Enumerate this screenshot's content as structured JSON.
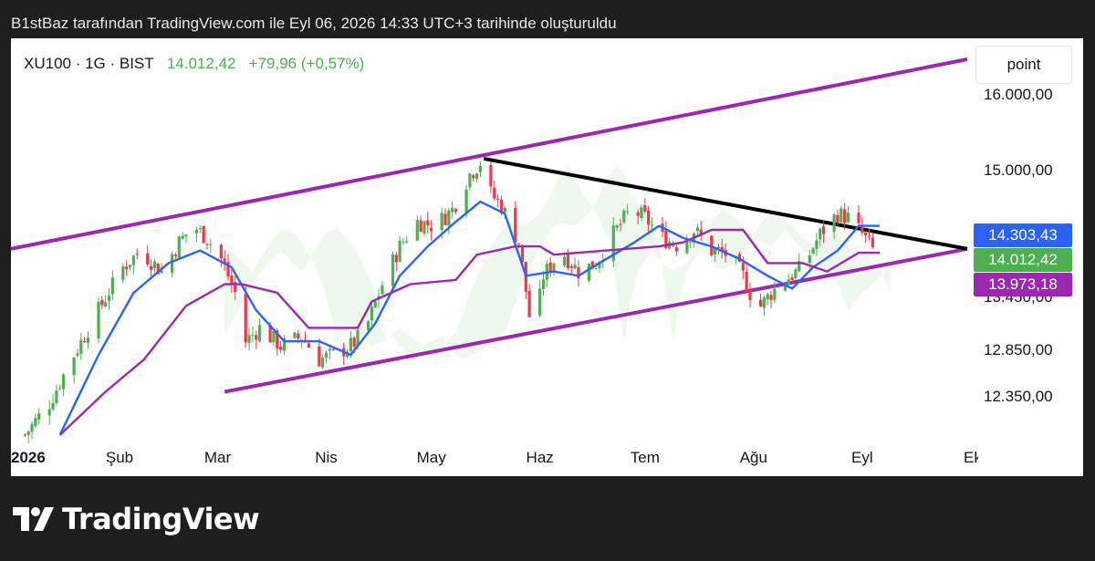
{
  "caption": "B1stBaz tarafından TradingView.com ile Eyl 06, 2026 14:33 UTC+3 tarihinde oluşturuldu",
  "header": {
    "symbol": "XU100 · 1G · BIST",
    "last": "14.012,42",
    "change": "+79,96 (+0,57%)"
  },
  "price_scale_mode": "point",
  "brand": {
    "name": "TradingView"
  },
  "colors": {
    "up": "#4caf50",
    "down": "#f23645",
    "channel": "#9c27b0",
    "conversion": "#2962ff",
    "base": "#7b1fa2",
    "trend": "#000000",
    "cloud_green": "#4caf50",
    "cloud_red": "#f23645"
  },
  "chart_data": {
    "type": "candlestick",
    "title": "XU100 · 1G · BIST",
    "y_scale": "log",
    "ylim": [
      11900,
      16800
    ],
    "y_ticks": [
      {
        "value": 16000,
        "label": "16.000,00"
      },
      {
        "value": 15000,
        "label": "15.000,00"
      },
      {
        "value": 13450,
        "label": "13.450,00"
      },
      {
        "value": 12850,
        "label": "12.850,00"
      },
      {
        "value": 12350,
        "label": "12.350,00"
      }
    ],
    "x_ticks": [
      {
        "date": "2026-01-01",
        "label": "2026"
      },
      {
        "date": "2026-02-01",
        "label": "Şub"
      },
      {
        "date": "2026-03-01",
        "label": "Mar"
      },
      {
        "date": "2026-04-01",
        "label": "Nis"
      },
      {
        "date": "2026-05-01",
        "label": "May"
      },
      {
        "date": "2026-06-01",
        "label": "Haz"
      },
      {
        "date": "2026-07-01",
        "label": "Tem"
      },
      {
        "date": "2026-08-01",
        "label": "Ağu"
      },
      {
        "date": "2026-09-01",
        "label": "Eyl"
      },
      {
        "date": "2026-10-01",
        "label": "Eki"
      }
    ],
    "xlim": [
      "2026-01-01",
      "2026-10-01"
    ],
    "price_badges": [
      {
        "name": "conversion_line",
        "value": "14.303,43",
        "color": "#2962ff"
      },
      {
        "name": "last_price",
        "value": "14.012,42",
        "color": "#4caf50"
      },
      {
        "name": "base_line",
        "value": "13.973,18",
        "color": "#9c27b0"
      }
    ],
    "close_path": [
      [
        "2026-01-05",
        11950
      ],
      [
        "2026-01-12",
        12280
      ],
      [
        "2026-01-19",
        12800
      ],
      [
        "2026-01-26",
        13300
      ],
      [
        "2026-02-02",
        13800
      ],
      [
        "2026-02-07",
        14000
      ],
      [
        "2026-02-13",
        13750
      ],
      [
        "2026-02-18",
        14100
      ],
      [
        "2026-02-22",
        14300
      ],
      [
        "2026-02-26",
        14150
      ],
      [
        "2026-03-02",
        13900
      ],
      [
        "2026-03-06",
        13500
      ],
      [
        "2026-03-09",
        12950
      ],
      [
        "2026-03-13",
        13100
      ],
      [
        "2026-03-19",
        12900
      ],
      [
        "2026-03-25",
        13000
      ],
      [
        "2026-03-30",
        12750
      ],
      [
        "2026-04-03",
        12800
      ],
      [
        "2026-04-08",
        12900
      ],
      [
        "2026-04-12",
        13050
      ],
      [
        "2026-04-17",
        13600
      ],
      [
        "2026-04-22",
        14050
      ],
      [
        "2026-04-27",
        14350
      ],
      [
        "2026-05-02",
        14300
      ],
      [
        "2026-05-07",
        14500
      ],
      [
        "2026-05-12",
        14950
      ],
      [
        "2026-05-15",
        15100
      ],
      [
        "2026-05-18",
        14700
      ],
      [
        "2026-05-21",
        14550
      ],
      [
        "2026-05-26",
        14100
      ],
      [
        "2026-05-30",
        12950
      ],
      [
        "2026-06-02",
        13700
      ],
      [
        "2026-06-07",
        14000
      ],
      [
        "2026-06-12",
        13750
      ],
      [
        "2026-06-17",
        13850
      ],
      [
        "2026-06-22",
        14200
      ],
      [
        "2026-06-27",
        14500
      ],
      [
        "2026-07-01",
        14400
      ],
      [
        "2026-07-06",
        14150
      ],
      [
        "2026-07-11",
        14050
      ],
      [
        "2026-07-15",
        14250
      ],
      [
        "2026-07-20",
        14000
      ],
      [
        "2026-07-25",
        13950
      ],
      [
        "2026-07-29",
        13700
      ],
      [
        "2026-08-02",
        13300
      ],
      [
        "2026-08-06",
        13500
      ],
      [
        "2026-08-10",
        13650
      ],
      [
        "2026-08-15",
        13800
      ],
      [
        "2026-08-20",
        14200
      ],
      [
        "2026-08-25",
        14450
      ],
      [
        "2026-08-28",
        14400
      ],
      [
        "2026-09-01",
        14200
      ],
      [
        "2026-09-04",
        14012
      ]
    ],
    "series": [
      {
        "name": "conversion_line",
        "color": "#2962ff",
        "points": [
          [
            "2026-01-15",
            11950
          ],
          [
            "2026-01-26",
            12800
          ],
          [
            "2026-02-05",
            13500
          ],
          [
            "2026-02-15",
            13850
          ],
          [
            "2026-02-24",
            14000
          ],
          [
            "2026-03-05",
            13800
          ],
          [
            "2026-03-12",
            13300
          ],
          [
            "2026-03-20",
            12950
          ],
          [
            "2026-03-30",
            12950
          ],
          [
            "2026-04-08",
            12800
          ],
          [
            "2026-04-15",
            13150
          ],
          [
            "2026-04-22",
            13700
          ],
          [
            "2026-04-30",
            14050
          ],
          [
            "2026-05-08",
            14350
          ],
          [
            "2026-05-15",
            14600
          ],
          [
            "2026-05-22",
            14450
          ],
          [
            "2026-05-28",
            13700
          ],
          [
            "2026-06-05",
            13750
          ],
          [
            "2026-06-12",
            13700
          ],
          [
            "2026-06-20",
            13900
          ],
          [
            "2026-06-28",
            14100
          ],
          [
            "2026-07-05",
            14300
          ],
          [
            "2026-07-12",
            14150
          ],
          [
            "2026-07-20",
            14050
          ],
          [
            "2026-07-28",
            13900
          ],
          [
            "2026-08-05",
            13700
          ],
          [
            "2026-08-12",
            13550
          ],
          [
            "2026-08-18",
            13800
          ],
          [
            "2026-08-25",
            14000
          ],
          [
            "2026-08-31",
            14300
          ],
          [
            "2026-09-06",
            14300
          ]
        ]
      },
      {
        "name": "base_line",
        "color": "#9c27b0",
        "points": [
          [
            "2026-01-15",
            11950
          ],
          [
            "2026-01-28",
            12400
          ],
          [
            "2026-02-08",
            12750
          ],
          [
            "2026-02-20",
            13350
          ],
          [
            "2026-03-03",
            13600
          ],
          [
            "2026-03-08",
            13600
          ],
          [
            "2026-03-18",
            13500
          ],
          [
            "2026-03-27",
            13100
          ],
          [
            "2026-04-10",
            13100
          ],
          [
            "2026-04-14",
            13400
          ],
          [
            "2026-04-25",
            13600
          ],
          [
            "2026-05-08",
            13650
          ],
          [
            "2026-05-14",
            13950
          ],
          [
            "2026-05-25",
            14050
          ],
          [
            "2026-06-01",
            14050
          ],
          [
            "2026-06-05",
            13950
          ],
          [
            "2026-06-20",
            14000
          ],
          [
            "2026-07-05",
            14050
          ],
          [
            "2026-07-12",
            14100
          ],
          [
            "2026-07-20",
            14250
          ],
          [
            "2026-07-29",
            14250
          ],
          [
            "2026-08-05",
            13850
          ],
          [
            "2026-08-15",
            13850
          ],
          [
            "2026-08-22",
            13750
          ],
          [
            "2026-08-31",
            13973
          ],
          [
            "2026-09-06",
            13973
          ]
        ]
      },
      {
        "name": "upper_channel",
        "color": "#9c27b0",
        "points": [
          [
            "2026-01-01",
            14020
          ],
          [
            "2026-10-01",
            16500
          ]
        ]
      },
      {
        "name": "lower_channel",
        "color": "#9c27b0",
        "points": [
          [
            "2026-03-03",
            12400
          ],
          [
            "2026-10-01",
            14020
          ]
        ]
      },
      {
        "name": "trendline",
        "color": "#000000",
        "points": [
          [
            "2026-05-16",
            15150
          ],
          [
            "2026-10-01",
            14020
          ]
        ]
      }
    ]
  }
}
